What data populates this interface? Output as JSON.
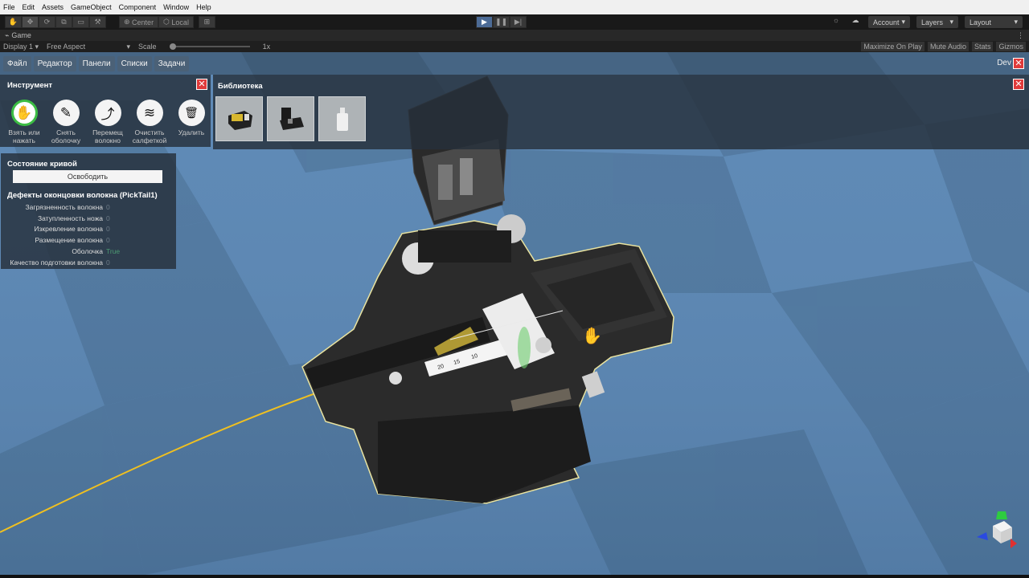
{
  "editor": {
    "menu": [
      "File",
      "Edit",
      "Assets",
      "GameObject",
      "Component",
      "Window",
      "Help"
    ],
    "pivot": [
      "Center",
      "Local"
    ],
    "account": "Account",
    "layers": "Layers",
    "layout": "Layout"
  },
  "game": {
    "tab": "Game",
    "display": "Display 1",
    "aspect": "Free Aspect",
    "scale_label": "Scale",
    "scale_value": "1x",
    "toggles": [
      "Maximize On Play",
      "Mute Audio",
      "Stats",
      "Gizmos"
    ]
  },
  "app": {
    "menu": [
      "Файл",
      "Редактор",
      "Панели",
      "Списки",
      "Задачи"
    ],
    "dev": "Dev",
    "close_glyph": "✕"
  },
  "tools": {
    "title": "Инструмент",
    "items": [
      {
        "label": "Взять или нажать",
        "icon": "hand-icon",
        "glyph": "✋"
      },
      {
        "label": "Снять оболочку",
        "icon": "pen-icon",
        "glyph": "✎"
      },
      {
        "label": "Перемещ волокно",
        "icon": "route-icon",
        "glyph": "⤴"
      },
      {
        "label": "Очистить салфеткой",
        "icon": "layers-icon",
        "glyph": "≋"
      },
      {
        "label": "Удалить",
        "icon": "trash-icon",
        "glyph": "🗑"
      }
    ]
  },
  "library": {
    "title": "Библиотека",
    "items": [
      "cleaver-yellow-item",
      "cleaver-black-item",
      "bottle-item"
    ]
  },
  "status": {
    "title": "Состояние кривой",
    "release": "Освободить",
    "defects_title": "Дефекты оконцовки волокна (PickTail1)",
    "rows": [
      {
        "k": "Загрязненность волокна",
        "v": "0"
      },
      {
        "k": "Затупленность ножа",
        "v": "0"
      },
      {
        "k": "Изкревление волокна",
        "v": "0"
      },
      {
        "k": "Размещение волокна",
        "v": "0"
      },
      {
        "k": "Оболочка",
        "v": "True"
      },
      {
        "k": "Качество подготовки волокна",
        "v": "0"
      }
    ]
  },
  "scene": {
    "ruler_labels": [
      "20",
      "15",
      "10"
    ],
    "fiber_color": "#f0c020",
    "floor_light": "#7aa3cc",
    "floor_dark": "#52799f"
  }
}
